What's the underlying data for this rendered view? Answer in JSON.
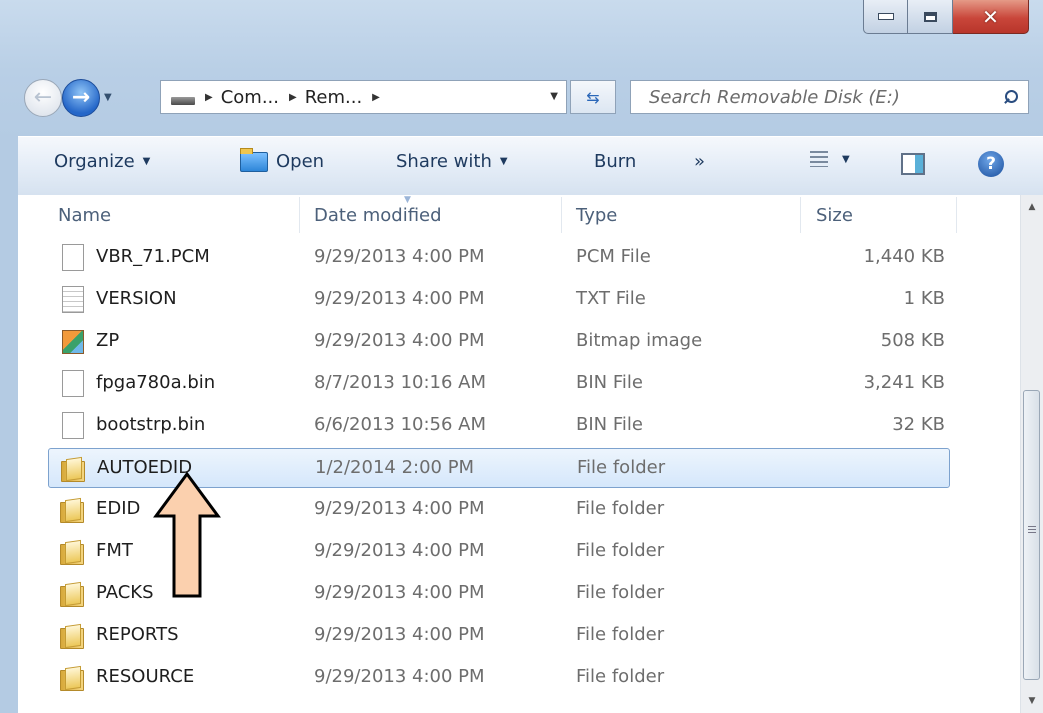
{
  "navbar": {
    "breadcrumb": [
      "Com...",
      "Rem..."
    ],
    "search_placeholder": "Search Removable Disk (E:)"
  },
  "toolbar": {
    "organize": "Organize",
    "open": "Open",
    "share_with": "Share with",
    "burn": "Burn",
    "more": "»"
  },
  "columns": {
    "name": "Name",
    "date": "Date modified",
    "type": "Type",
    "size": "Size"
  },
  "files": [
    {
      "name": "VBR_71.PCM",
      "date": "9/29/2013 4:00 PM",
      "type": "PCM File",
      "size": "1,440 KB",
      "icon": "file-icon"
    },
    {
      "name": "VERSION",
      "date": "9/29/2013 4:00 PM",
      "type": "TXT File",
      "size": "1 KB",
      "icon": "text-file-icon"
    },
    {
      "name": "ZP",
      "date": "9/29/2013 4:00 PM",
      "type": "Bitmap image",
      "size": "508 KB",
      "icon": "bitmap-icon"
    },
    {
      "name": "fpga780a.bin",
      "date": "8/7/2013 10:16 AM",
      "type": "BIN File",
      "size": "3,241 KB",
      "icon": "file-icon"
    },
    {
      "name": "bootstrp.bin",
      "date": "6/6/2013 10:56 AM",
      "type": "BIN File",
      "size": "32 KB",
      "icon": "file-icon"
    },
    {
      "name": "AUTOEDID",
      "date": "1/2/2014 2:00 PM",
      "type": "File folder",
      "size": "",
      "icon": "folder-icon",
      "selected": true
    },
    {
      "name": "EDID",
      "date": "9/29/2013 4:00 PM",
      "type": "File folder",
      "size": "",
      "icon": "folder-icon"
    },
    {
      "name": "FMT",
      "date": "9/29/2013 4:00 PM",
      "type": "File folder",
      "size": "",
      "icon": "folder-icon"
    },
    {
      "name": "PACKS",
      "date": "9/29/2013 4:00 PM",
      "type": "File folder",
      "size": "",
      "icon": "folder-icon"
    },
    {
      "name": "REPORTS",
      "date": "9/29/2013 4:00 PM",
      "type": "File folder",
      "size": "",
      "icon": "folder-icon"
    },
    {
      "name": "RESOURCE",
      "date": "9/29/2013 4:00 PM",
      "type": "File folder",
      "size": "",
      "icon": "folder-icon"
    }
  ],
  "annotation": {
    "icon": "up-arrow-icon",
    "fill": "#fbd0ae",
    "stroke": "#000000"
  }
}
